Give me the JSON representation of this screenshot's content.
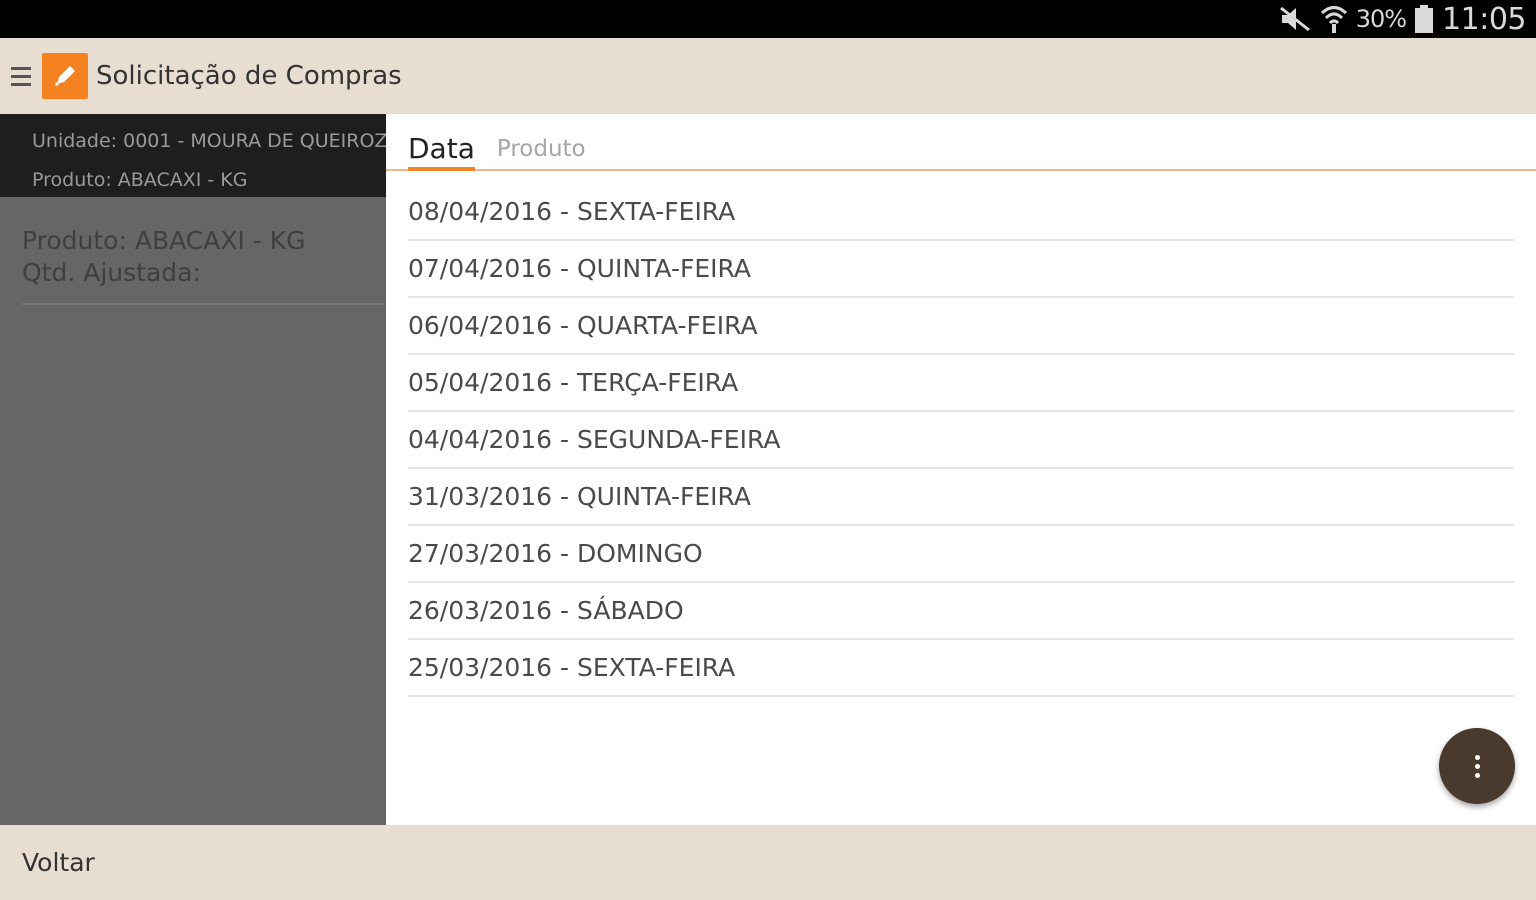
{
  "status_bar": {
    "icons": [
      "mute-icon",
      "wifi-icon",
      "battery-icon"
    ],
    "battery": "30%",
    "time": "11:05"
  },
  "app_bar": {
    "title": "Solicitação de Compras",
    "menu_icon": "hamburger-icon",
    "logo_icon": "pencil-icon"
  },
  "left_panel": {
    "unidade": "Unidade: 0001 - MOURA DE QUEIROZ",
    "produto": "Produto: ABACAXI - KG",
    "detail_produto": "Produto: ABACAXI - KG",
    "detail_qtd": "Qtd. Ajustada:"
  },
  "tabs": [
    {
      "label": "Data",
      "active": true
    },
    {
      "label": "Produto",
      "active": false
    }
  ],
  "dates": [
    "08/04/2016 - SEXTA-FEIRA",
    "07/04/2016 - QUINTA-FEIRA",
    "06/04/2016 - QUARTA-FEIRA",
    "05/04/2016 - TERÇA-FEIRA",
    "04/04/2016 - SEGUNDA-FEIRA",
    "31/03/2016 - QUINTA-FEIRA",
    "27/03/2016 - DOMINGO",
    "26/03/2016 - SÁBADO",
    "25/03/2016 - SEXTA-FEIRA"
  ],
  "fab_icon": "more-vert-icon",
  "bottom_bar": {
    "voltar": "Voltar"
  },
  "colors": {
    "accent": "#f58220",
    "app_bar": "#e8ddd1",
    "fab": "#4a3a2d"
  }
}
